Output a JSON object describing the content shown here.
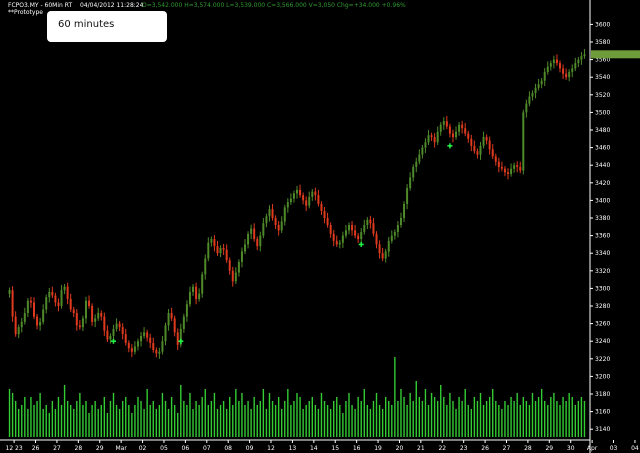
{
  "header": {
    "symbol_line": "FCPO3.MY - 60Min RT",
    "datetime": "04/04/2012  11:28:24",
    "ohlc": "O=3,542.000  H=3,574.000  L=3,539.000  C=3,566.000  V=3,050  Chg=+34.000  +0.96%",
    "prototype_label": "**Prototype"
  },
  "note": {
    "text": "60 minutes"
  },
  "colors": {
    "background": "#000000",
    "up_bar": "#4f8a2a",
    "down_bar": "#e03a1e",
    "volume": "#33cc33",
    "signal": "#22ee44",
    "last_price_marker": "#6f9c3a",
    "header_green": "#2f9a2f",
    "axis_text": "#ffffff"
  },
  "chart_data": {
    "type": "bar",
    "title": "",
    "xlabel": "",
    "ylabel": "",
    "y_ticks": [
      3140,
      3160,
      3180,
      3200,
      3220,
      3240,
      3260,
      3280,
      3300,
      3320,
      3340,
      3360,
      3380,
      3400,
      3420,
      3440,
      3460,
      3480,
      3500,
      3520,
      3540,
      3560,
      3580,
      3600
    ],
    "ylim": [
      3130,
      3605
    ],
    "x_ticks": [
      "12 23",
      "26",
      "27",
      "28",
      "29",
      "Mar",
      "02",
      "05",
      "06",
      "07",
      "08",
      "09",
      "12",
      "13",
      "14",
      "15",
      "16",
      "19",
      "20",
      "21",
      "22",
      "23",
      "26",
      "27",
      "28",
      "29",
      "30",
      "Apr",
      "03",
      "04"
    ],
    "last_price": 3566,
    "grid": false,
    "price_series": {
      "name": "FCPO3.MY",
      "points_per_day": 7,
      "close": [
        3298,
        3268,
        3248,
        3256,
        3262,
        3272,
        3286,
        3284,
        3268,
        3258,
        3262,
        3276,
        3290,
        3296,
        3292,
        3284,
        3280,
        3298,
        3302,
        3288,
        3276,
        3272,
        3258,
        3256,
        3266,
        3286,
        3280,
        3262,
        3266,
        3272,
        3268,
        3252,
        3242,
        3246,
        3254,
        3260,
        3256,
        3248,
        3238,
        3232,
        3228,
        3234,
        3240,
        3246,
        3250,
        3244,
        3238,
        3230,
        3226,
        3228,
        3240,
        3258,
        3272,
        3266,
        3250,
        3236,
        3254,
        3268,
        3282,
        3296,
        3302,
        3288,
        3294,
        3316,
        3334,
        3352,
        3356,
        3348,
        3340,
        3346,
        3344,
        3332,
        3320,
        3308,
        3318,
        3330,
        3342,
        3350,
        3362,
        3368,
        3356,
        3348,
        3360,
        3374,
        3382,
        3390,
        3380,
        3372,
        3366,
        3376,
        3392,
        3398,
        3402,
        3408,
        3412,
        3406,
        3400,
        3394,
        3404,
        3410,
        3406,
        3396,
        3388,
        3380,
        3372,
        3362,
        3354,
        3350,
        3352,
        3360,
        3366,
        3372,
        3366,
        3360,
        3356,
        3364,
        3372,
        3378,
        3374,
        3362,
        3350,
        3340,
        3334,
        3342,
        3354,
        3360,
        3364,
        3372,
        3380,
        3396,
        3414,
        3426,
        3438,
        3444,
        3452,
        3460,
        3466,
        3474,
        3472,
        3466,
        3478,
        3486,
        3490,
        3484,
        3476,
        3472,
        3478,
        3486,
        3482,
        3476,
        3470,
        3462,
        3456,
        3452,
        3462,
        3472,
        3468,
        3458,
        3450,
        3444,
        3438,
        3436,
        3432,
        3430,
        3436,
        3440,
        3438,
        3434,
        3500,
        3510,
        3518,
        3522,
        3528,
        3532,
        3536,
        3546,
        3552,
        3556,
        3560,
        3556,
        3550,
        3544,
        3540,
        3546,
        3550,
        3556,
        3560,
        3564,
        3566
      ],
      "signals": [
        {
          "index": 34,
          "direction": "up"
        },
        {
          "index": 56,
          "direction": "up"
        },
        {
          "index": 115,
          "direction": "up"
        },
        {
          "index": 144,
          "direction": "up"
        },
        {
          "index": 201,
          "direction": "up"
        }
      ]
    },
    "volume_series": {
      "name": "Volume",
      "values": [
        12,
        11,
        9,
        7,
        8,
        10,
        7,
        10,
        8,
        9,
        11,
        7,
        8,
        6,
        9,
        7,
        10,
        8,
        13,
        9,
        8,
        7,
        9,
        11,
        8,
        9,
        6,
        8,
        9,
        7,
        8,
        10,
        6,
        9,
        11,
        8,
        7,
        9,
        10,
        8,
        6,
        8,
        10,
        9,
        7,
        12,
        8,
        9,
        7,
        8,
        11,
        9,
        7,
        10,
        8,
        6,
        13,
        9,
        8,
        11,
        7,
        9,
        8,
        10,
        12,
        8,
        9,
        11,
        7,
        8,
        9,
        7,
        10,
        8,
        12,
        9,
        11,
        8,
        9,
        7,
        10,
        8,
        9,
        12,
        7,
        11,
        9,
        8,
        10,
        7,
        9,
        12,
        8,
        9,
        11,
        10,
        7,
        8,
        9,
        10,
        8,
        7,
        11,
        9,
        8,
        7,
        9,
        10,
        8,
        6,
        9,
        11,
        8,
        7,
        10,
        9,
        12,
        8,
        7,
        9,
        11,
        8,
        7,
        10,
        9,
        8,
        20,
        9,
        12,
        10,
        8,
        11,
        9,
        14,
        10,
        9,
        12,
        8,
        11,
        10,
        9,
        13,
        10,
        8,
        11,
        9,
        7,
        10,
        9,
        12,
        8,
        7,
        10,
        9,
        11,
        8,
        9,
        10,
        12,
        9,
        8,
        7,
        9,
        8,
        10,
        9,
        11,
        8,
        10,
        9,
        8,
        11,
        9,
        10,
        12,
        9,
        8,
        10,
        11,
        9,
        8,
        10,
        9,
        11,
        10,
        8,
        9,
        10,
        9
      ],
      "ylim": [
        0,
        22
      ]
    }
  }
}
